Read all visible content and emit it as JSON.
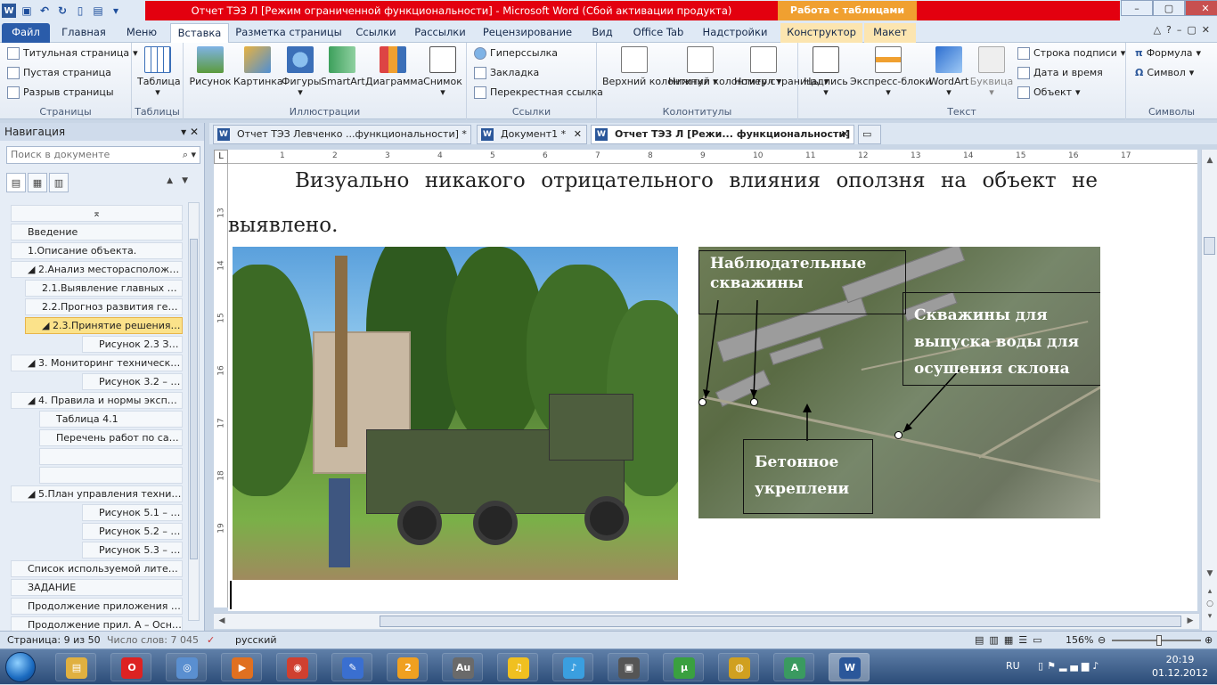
{
  "title": {
    "text": "Отчет ТЭЗ Л [Режим ограниченной функциональности]  -  Microsoft Word (Сбой активации продукта)",
    "context_tab": "Работа с таблицами"
  },
  "ribbon_tabs": [
    "Файл",
    "Главная",
    "Меню",
    "Вставка",
    "Разметка страницы",
    "Ссылки",
    "Рассылки",
    "Рецензирование",
    "Вид",
    "Office Tab",
    "Надстройки",
    "Конструктор",
    "Макет"
  ],
  "groups": {
    "pages": {
      "label": "Страницы",
      "items": [
        "Титульная страница",
        "Пустая страница",
        "Разрыв страницы"
      ]
    },
    "tables": {
      "label": "Таблицы",
      "items": [
        "Таблица"
      ]
    },
    "illustrations": {
      "label": "Иллюстрации",
      "items": [
        "Рисунок",
        "Картинка",
        "Фигуры",
        "SmartArt",
        "Диаграмма",
        "Снимок"
      ]
    },
    "links": {
      "label": "Ссылки",
      "items": [
        "Гиперссылка",
        "Закладка",
        "Перекрестная ссылка"
      ]
    },
    "headers": {
      "label": "Колонтитулы",
      "items": [
        "Верхний колонтитул",
        "Нижний колонтитул",
        "Номер страницы"
      ]
    },
    "text": {
      "label": "Текст",
      "items": [
        "Надпись",
        "Экспресс-блоки",
        "WordArt",
        "Буквица",
        "Строка подписи",
        "Дата и время",
        "Объект"
      ]
    },
    "symbols": {
      "label": "Символы",
      "items": [
        "Формула",
        "Символ"
      ]
    }
  },
  "nav": {
    "title": "Навигация",
    "search_placeholder": "Поиск в документе",
    "items": [
      {
        "text": "Введение",
        "indent": 0
      },
      {
        "text": "1.Описание объекта.",
        "indent": 0
      },
      {
        "text": "◢ 2.Анализ месторасположения",
        "indent": 0
      },
      {
        "text": "2.1.Выявление главных фа...",
        "indent": 1
      },
      {
        "text": "2.2.Прогноз развития геол...",
        "indent": 1
      },
      {
        "text": "◢ 2.3.Принятие решения о с...",
        "indent": 1,
        "selected": true
      },
      {
        "text": "Рисунок 2.3 Зо...",
        "indent": 3
      },
      {
        "text": "◢ 3. Мониторинг технического ...",
        "indent": 0
      },
      {
        "text": "Рисунок 3.2 – П...",
        "indent": 3
      },
      {
        "text": "◢ 4. Правила и нормы эксплуата...",
        "indent": 0
      },
      {
        "text": "Таблица 4.1",
        "indent": 2
      },
      {
        "text": "Перечень работ по сан...",
        "indent": 2
      },
      {
        "text": "",
        "indent": 2
      },
      {
        "text": "",
        "indent": 2
      },
      {
        "text": "◢ 5.План управления техническ...",
        "indent": 0
      },
      {
        "text": "Рисунок 5.1 – П...",
        "indent": 3
      },
      {
        "text": "Рисунок 5.2 – П...",
        "indent": 3
      },
      {
        "text": "Рисунок 5.3 – П...",
        "indent": 3
      },
      {
        "text": "Список используемой литера...",
        "indent": 0
      },
      {
        "text": "ЗАДАНИЕ",
        "indent": 0
      },
      {
        "text": "Продолжение приложения А...",
        "indent": 0
      },
      {
        "text": "Продолжение прил. А – Осно...",
        "indent": 0
      }
    ]
  },
  "doc_tabs": [
    {
      "label": "Отчет ТЭЗ Левченко ...функциональности] *",
      "active": false
    },
    {
      "label": "Документ1 *",
      "active": false
    },
    {
      "label": "Отчет ТЭЗ Л [Режи... функциональности]",
      "active": true
    }
  ],
  "ruler": {
    "h": [
      "1",
      "2",
      "3",
      "4",
      "5",
      "6",
      "7",
      "8",
      "9",
      "10",
      "11",
      "12",
      "13",
      "14",
      "15",
      "16",
      "17"
    ],
    "v": [
      "13",
      "14",
      "15",
      "16",
      "17",
      "18",
      "19"
    ]
  },
  "document": {
    "paragraph": "Визуально никакого отрицательного влияния оползня на объект не выявлено.",
    "callouts": {
      "observation": "Наблюдательные скважины",
      "drainage": "Скважины для выпуска воды для осушения склона",
      "concrete": "Бетонное укреплени"
    }
  },
  "status": {
    "page": "Страница: 9 из 50",
    "words": "Число слов: 7 045",
    "language": "русский",
    "zoom": "156%"
  },
  "taskbar": {
    "apps": [
      "Проводник",
      "Opera",
      "Сеть",
      "Media Player",
      "Chrome",
      "Paint",
      "2ГИС",
      "Au",
      "Audio",
      "Music",
      "Flash",
      "uTorrent",
      "Media",
      "AutoCAD",
      "Word"
    ],
    "lang": "RU",
    "time": "20:19",
    "date": "01.12.2012"
  }
}
